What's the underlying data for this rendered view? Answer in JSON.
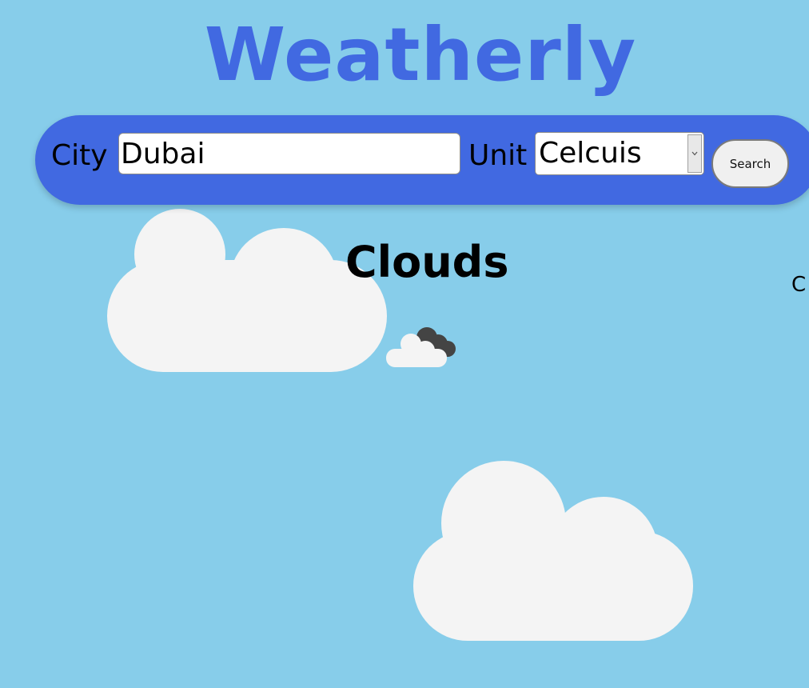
{
  "header": {
    "title": "Weatherly",
    "title_color": "#4169E1"
  },
  "search_bar": {
    "city_label": "City",
    "city_value": "Dubai",
    "unit_label": "Unit",
    "unit_selected": "Celcuis",
    "search_button": "Search",
    "background_color": "#4169E1"
  },
  "weather": {
    "condition": "Clouds",
    "condition_icon": "few-clouds-icon",
    "truncated_text": "C"
  },
  "decor": {
    "background_color": "#87CDEA",
    "cloud_color": "#F4F4F4",
    "clouds": [
      "cloud-decoration",
      "cloud-decoration"
    ]
  }
}
